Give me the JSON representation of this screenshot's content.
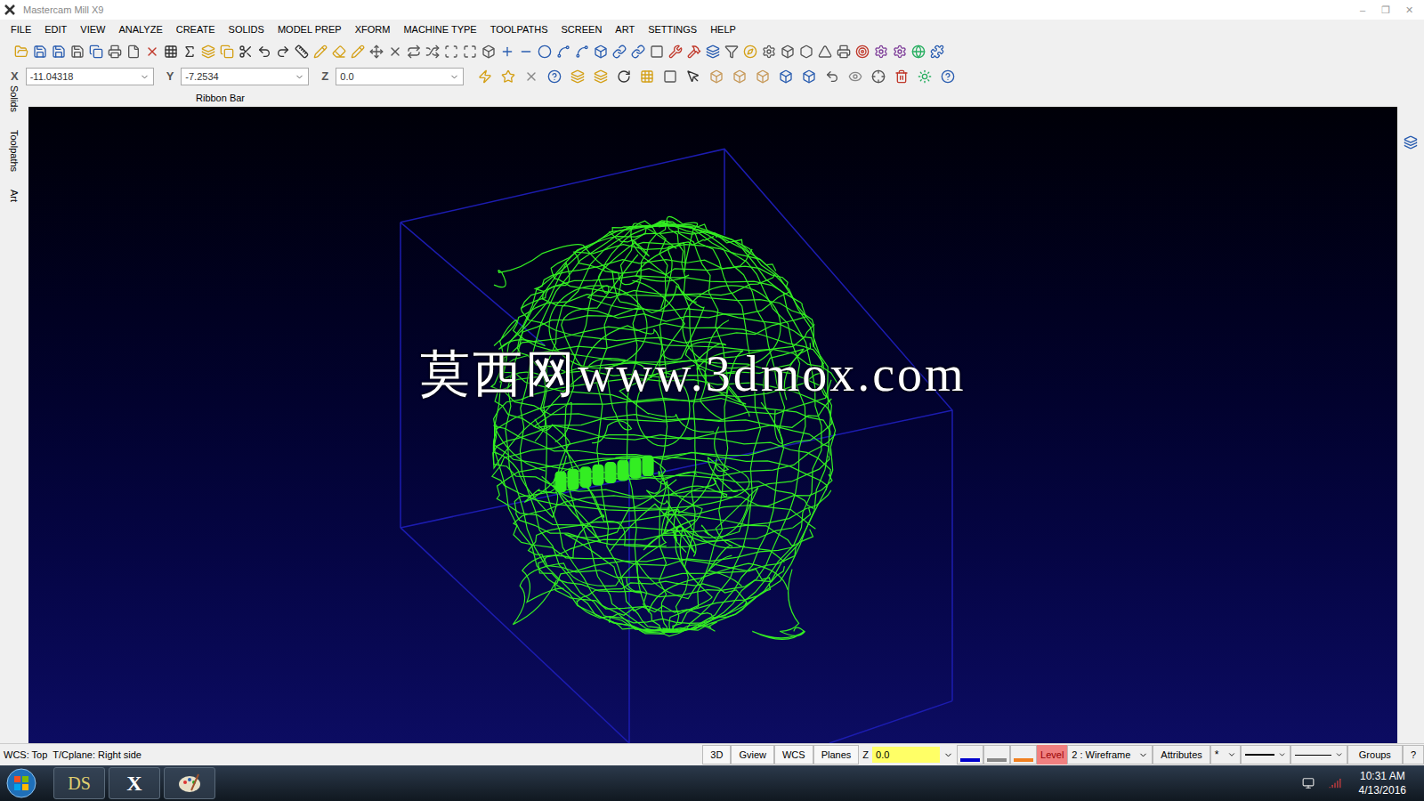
{
  "window": {
    "title": "Mastercam Mill X9",
    "controls": [
      "–",
      "❐",
      "✕"
    ]
  },
  "menu": [
    "FILE",
    "EDIT",
    "VIEW",
    "ANALYZE",
    "CREATE",
    "SOLIDS",
    "MODEL PREP",
    "XFORM",
    "MACHINE TYPE",
    "TOOLPATHS",
    "SCREEN",
    "ART",
    "SETTINGS",
    "HELP"
  ],
  "coordinates": [
    {
      "label": "X",
      "value": "-11.04318"
    },
    {
      "label": "Y",
      "value": "-7.2534"
    },
    {
      "label": "Z",
      "value": "0.0"
    }
  ],
  "ribbon_bar": {
    "label": "Ribbon Bar"
  },
  "side_tabs": [
    "Solids",
    "Toolpaths",
    "Art"
  ],
  "viewport": {
    "watermark": "莫西网www.3dmox.com"
  },
  "status_bar": {
    "wcs": "WCS: Top",
    "cplane": "T/Cplane: Right side",
    "buttons": [
      "3D",
      "Gview",
      "WCS",
      "Planes"
    ],
    "z_label": "Z",
    "z_value": "0.0",
    "level_label": "Level",
    "level_value": "2 : Wireframe",
    "attributes": "Attributes",
    "point_style": "*",
    "groups": "Groups",
    "help": "?"
  },
  "taskbar": {
    "apps": [
      {
        "kind": "solidworks",
        "label": "DS"
      },
      {
        "kind": "mastercam",
        "label": "X"
      },
      {
        "kind": "paint",
        "label": ""
      }
    ],
    "time": "10:31 AM",
    "date": "4/13/2016"
  }
}
